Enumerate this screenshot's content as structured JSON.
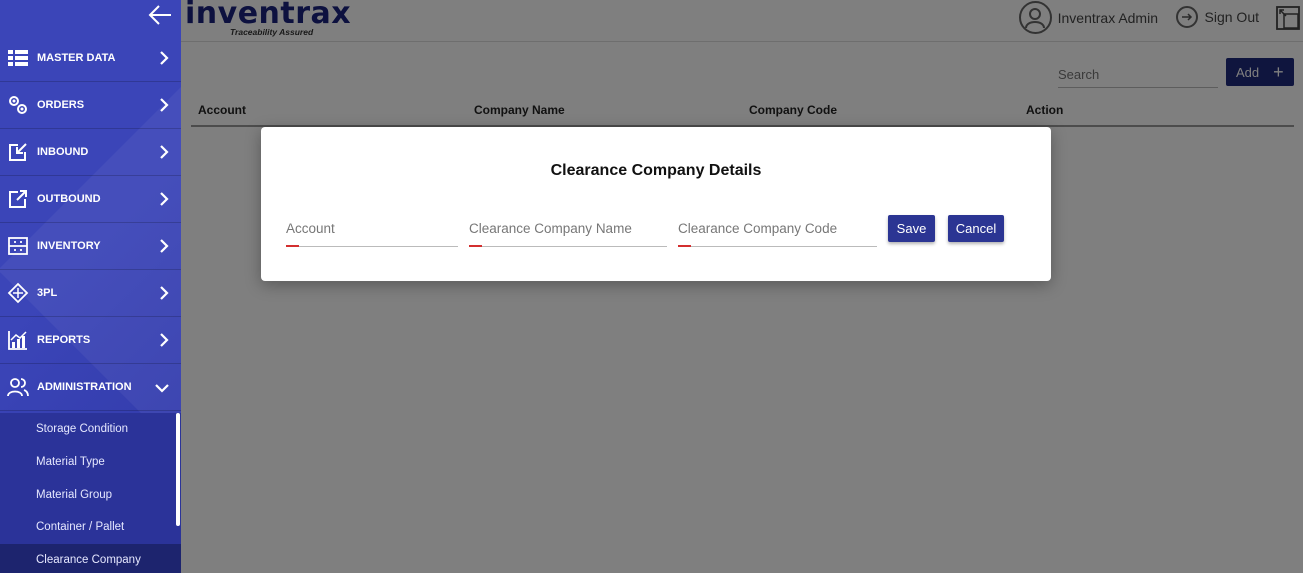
{
  "sidebar": {
    "items": [
      {
        "label": "MASTER DATA",
        "icon": "list-icon"
      },
      {
        "label": "ORDERS",
        "icon": "gears-icon"
      },
      {
        "label": "INBOUND",
        "icon": "inbound-icon"
      },
      {
        "label": "OUTBOUND",
        "icon": "outbound-icon"
      },
      {
        "label": "INVENTORY",
        "icon": "inventory-icon"
      },
      {
        "label": "3PL",
        "icon": "3pl-icon"
      },
      {
        "label": "REPORTS",
        "icon": "reports-icon"
      },
      {
        "label": "ADMINISTRATION",
        "icon": "users-icon"
      }
    ],
    "submenu": [
      {
        "label": "Storage Condition"
      },
      {
        "label": "Material Type"
      },
      {
        "label": "Material Group"
      },
      {
        "label": "Container / Pallet"
      },
      {
        "label": "Clearance Company"
      }
    ]
  },
  "header": {
    "logo": "inventrax",
    "tagline": "Traceability Assured",
    "user_name": "Inventrax Admin",
    "signout_label": "Sign Out"
  },
  "toolbar": {
    "search_placeholder": "Search",
    "add_label": "Add"
  },
  "table": {
    "columns": [
      "Account",
      "Company Name",
      "Company Code",
      "Action"
    ]
  },
  "modal": {
    "title": "Clearance Company Details",
    "fields": [
      {
        "placeholder": "Account"
      },
      {
        "placeholder": "Clearance Company Name"
      },
      {
        "placeholder": "Clearance Company Code"
      }
    ],
    "save_label": "Save",
    "cancel_label": "Cancel"
  },
  "colors": {
    "sidebar": "#3b45b8",
    "primary_button": "#1f2a7c",
    "required_mark": "#d32f2f"
  }
}
